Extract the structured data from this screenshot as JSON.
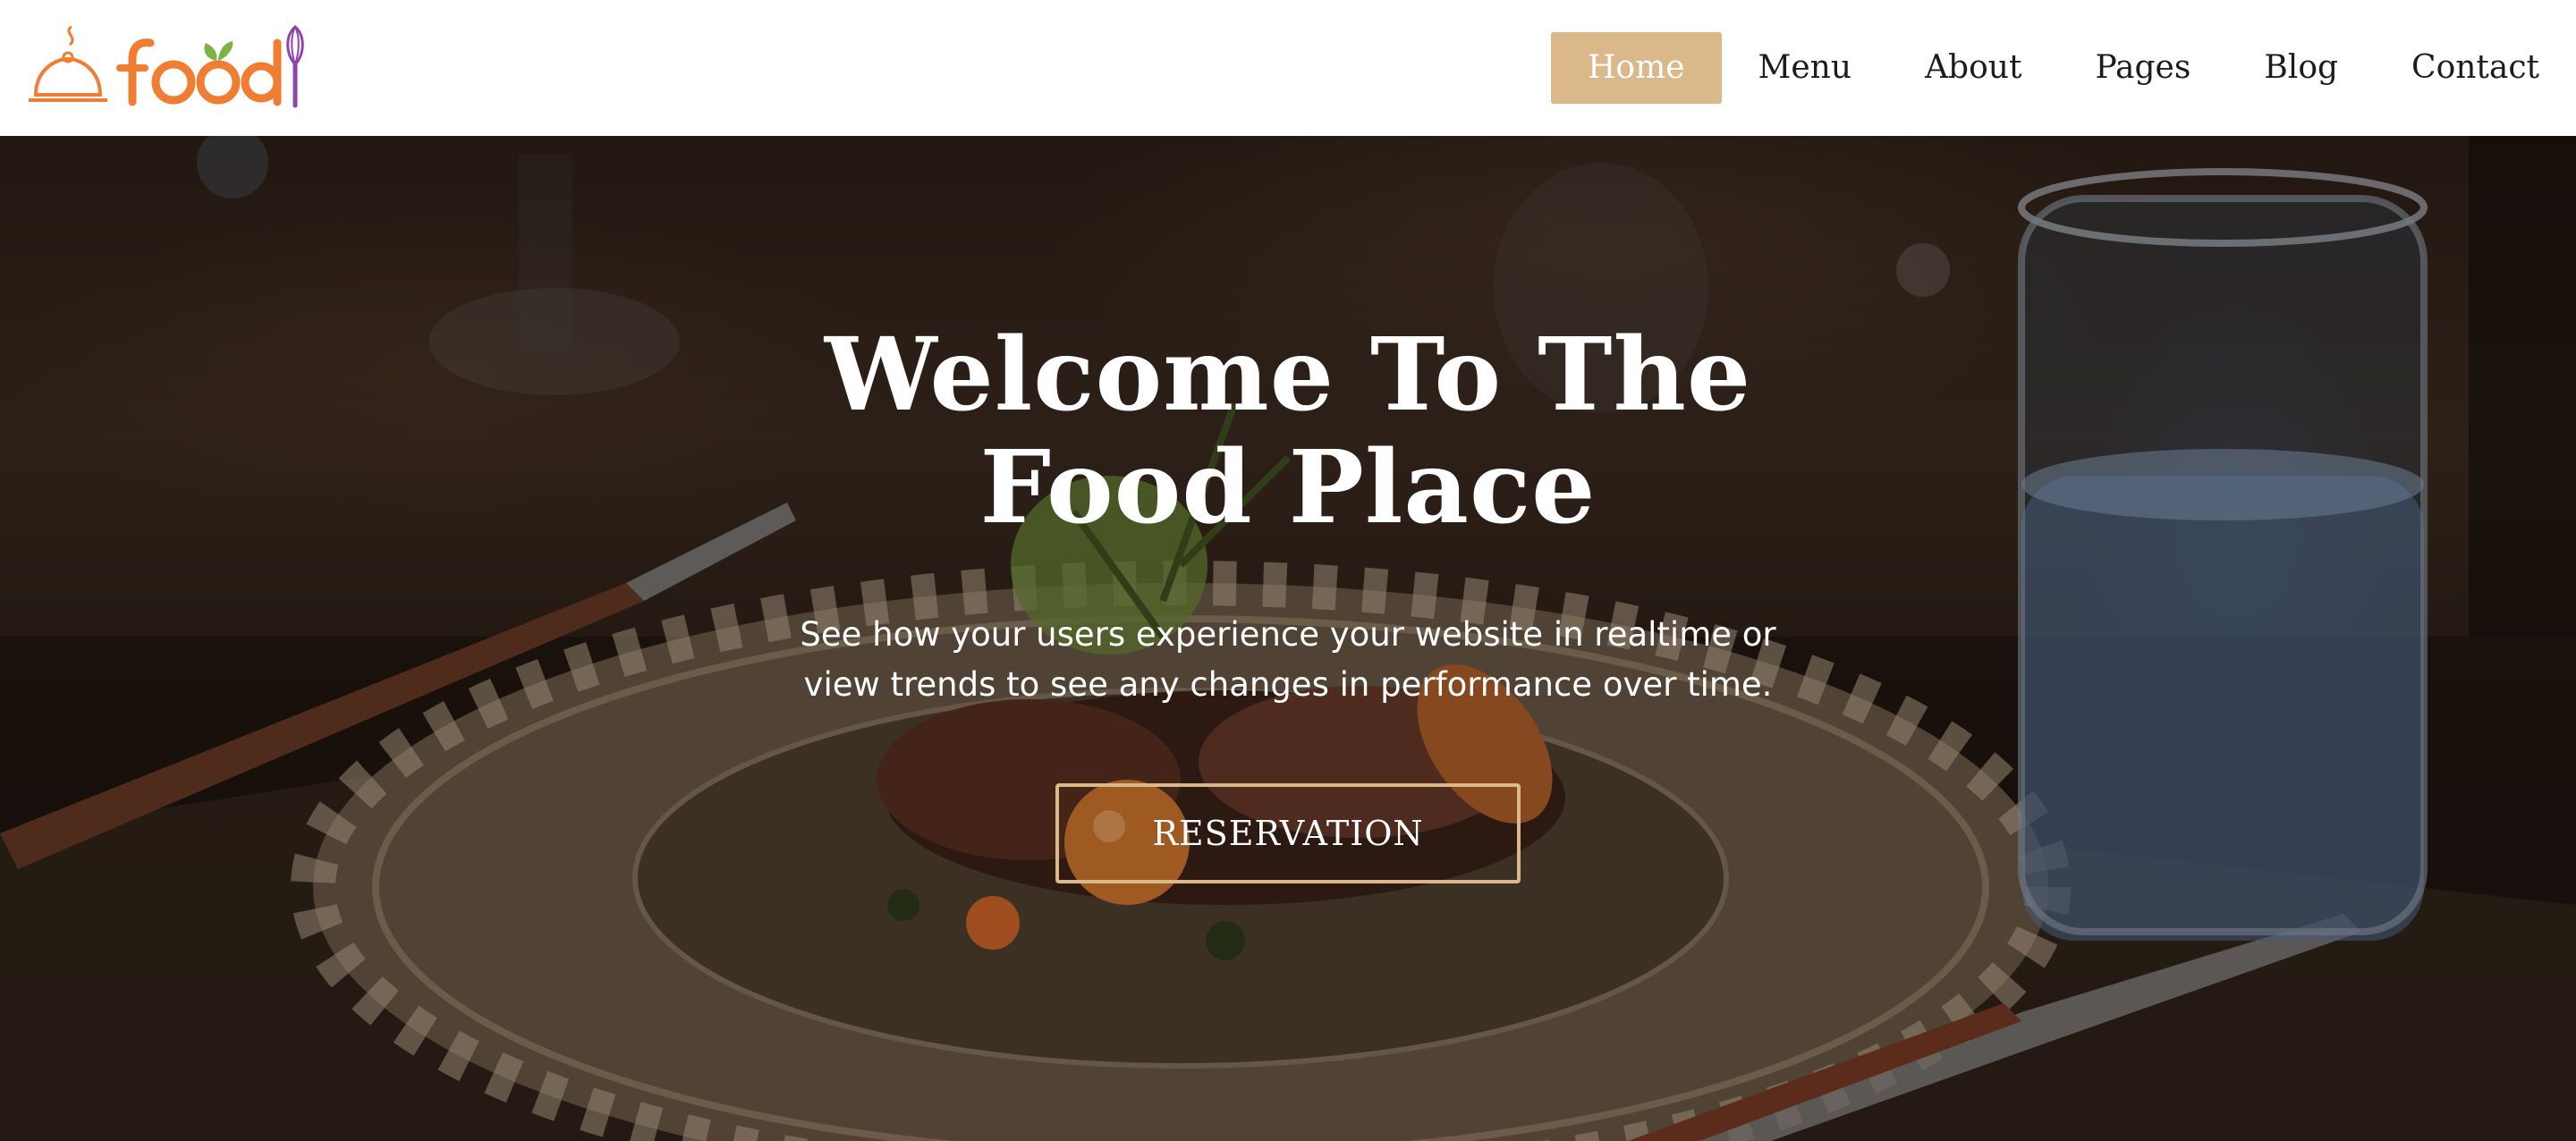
{
  "header": {
    "logo_text": "food",
    "nav": [
      {
        "label": "Home",
        "active": true
      },
      {
        "label": "Menu",
        "active": false
      },
      {
        "label": "About",
        "active": false
      },
      {
        "label": "Pages",
        "active": false
      },
      {
        "label": "Blog",
        "active": false
      },
      {
        "label": "Contact",
        "active": false
      }
    ]
  },
  "hero": {
    "title_line1": "Welcome To The",
    "title_line2": "Food Place",
    "subtitle_line1": "See how your users experience your website in realtime or",
    "subtitle_line2": "view trends to see any changes in performance over time.",
    "cta_label": "RESERVATION",
    "background_description_icon": "restaurant-plate-photo"
  },
  "colors": {
    "accent": "#dbb889",
    "logo_orange": "#ef7d32",
    "logo_green": "#7cb342",
    "logo_purple": "#8e44ad",
    "text_dark": "#1c1c1c",
    "hero_text": "#ffffff"
  }
}
